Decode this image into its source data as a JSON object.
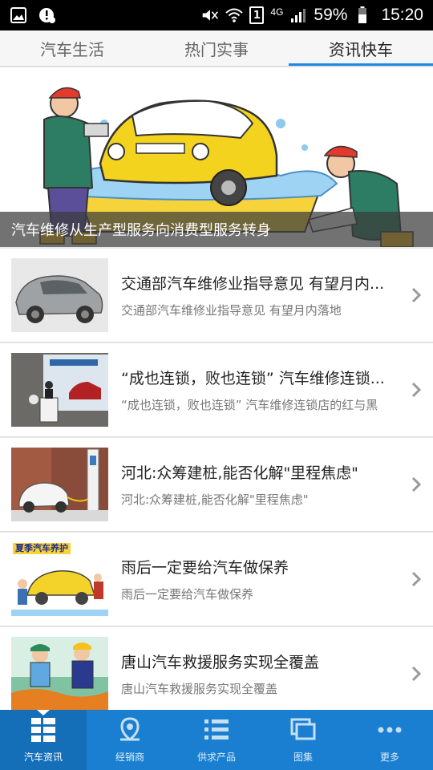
{
  "status_bar": {
    "network": "4G",
    "battery": "59%",
    "time": "15:20",
    "sim": "1"
  },
  "tabs": [
    {
      "label": "汽车生活"
    },
    {
      "label": "热门实事"
    },
    {
      "label": "资讯快车"
    }
  ],
  "banner": {
    "caption": "汽车维修从生产型服务向消费型服务转身"
  },
  "news": [
    {
      "title": "交通部汽车维修业指导意见 有望月内...",
      "summary": "交通部汽车维修业指导意见 有望月内落地"
    },
    {
      "title": "“成也连锁，败也连锁” 汽车维修连锁...",
      "summary": "“成也连锁，败也连锁” 汽车维修连锁店的红与黑"
    },
    {
      "title": "河北:众筹建桩,能否化解\"里程焦虑\"",
      "summary": "河北:众筹建桩,能否化解\"里程焦虑\""
    },
    {
      "title": "雨后一定要给汽车做保养",
      "summary": "雨后一定要给汽车做保养"
    },
    {
      "title": "唐山汽车救援服务实现全覆盖",
      "summary": "唐山汽车救援服务实现全覆盖"
    }
  ],
  "thumb_text": {
    "news_3_banner": "夏季汽车养护"
  },
  "bottom_nav": [
    {
      "label": "汽车资讯"
    },
    {
      "label": "经销商"
    },
    {
      "label": "供求产品"
    },
    {
      "label": "图集"
    },
    {
      "label": "更多"
    }
  ],
  "colors": {
    "accent": "#1e88e5",
    "nav_bg": "#1a7fd0"
  }
}
